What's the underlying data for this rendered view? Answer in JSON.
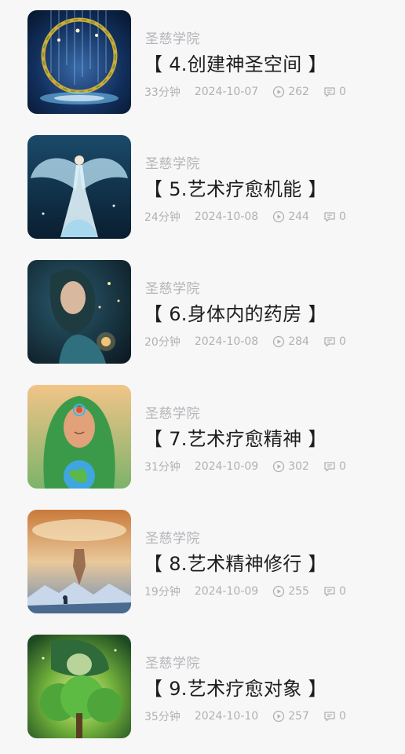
{
  "items": [
    {
      "author": "圣慈学院",
      "title": "【 4.创建神圣空间 】",
      "duration": "33分钟",
      "date": "2024-10-07",
      "views": "262",
      "comments": "0",
      "thumb_icon": "golden-wreath-portal-image"
    },
    {
      "author": "圣慈学院",
      "title": "【 5.艺术疗愈机能 】",
      "duration": "24分钟",
      "date": "2024-10-08",
      "views": "244",
      "comments": "0",
      "thumb_icon": "dancing-woman-wings-image"
    },
    {
      "author": "圣慈学院",
      "title": "【 6.身体内的药房 】",
      "duration": "20分钟",
      "date": "2024-10-08",
      "views": "284",
      "comments": "0",
      "thumb_icon": "glowing-woman-portrait-image"
    },
    {
      "author": "圣慈学院",
      "title": "【 7.艺术疗愈精神 】",
      "duration": "31分钟",
      "date": "2024-10-09",
      "views": "302",
      "comments": "0",
      "thumb_icon": "goddess-earth-image"
    },
    {
      "author": "圣慈学院",
      "title": "【 8.艺术精神修行 】",
      "duration": "19分钟",
      "date": "2024-10-09",
      "views": "255",
      "comments": "0",
      "thumb_icon": "meditation-mountains-image"
    },
    {
      "author": "圣慈学院",
      "title": "【 9.艺术疗愈对象 】",
      "duration": "35分钟",
      "date": "2024-10-10",
      "views": "257",
      "comments": "0",
      "thumb_icon": "green-tree-woman-image"
    }
  ],
  "colors": {
    "background": "#f7f7f8",
    "title": "#1d1d1f",
    "muted": "#b1b1b5"
  }
}
